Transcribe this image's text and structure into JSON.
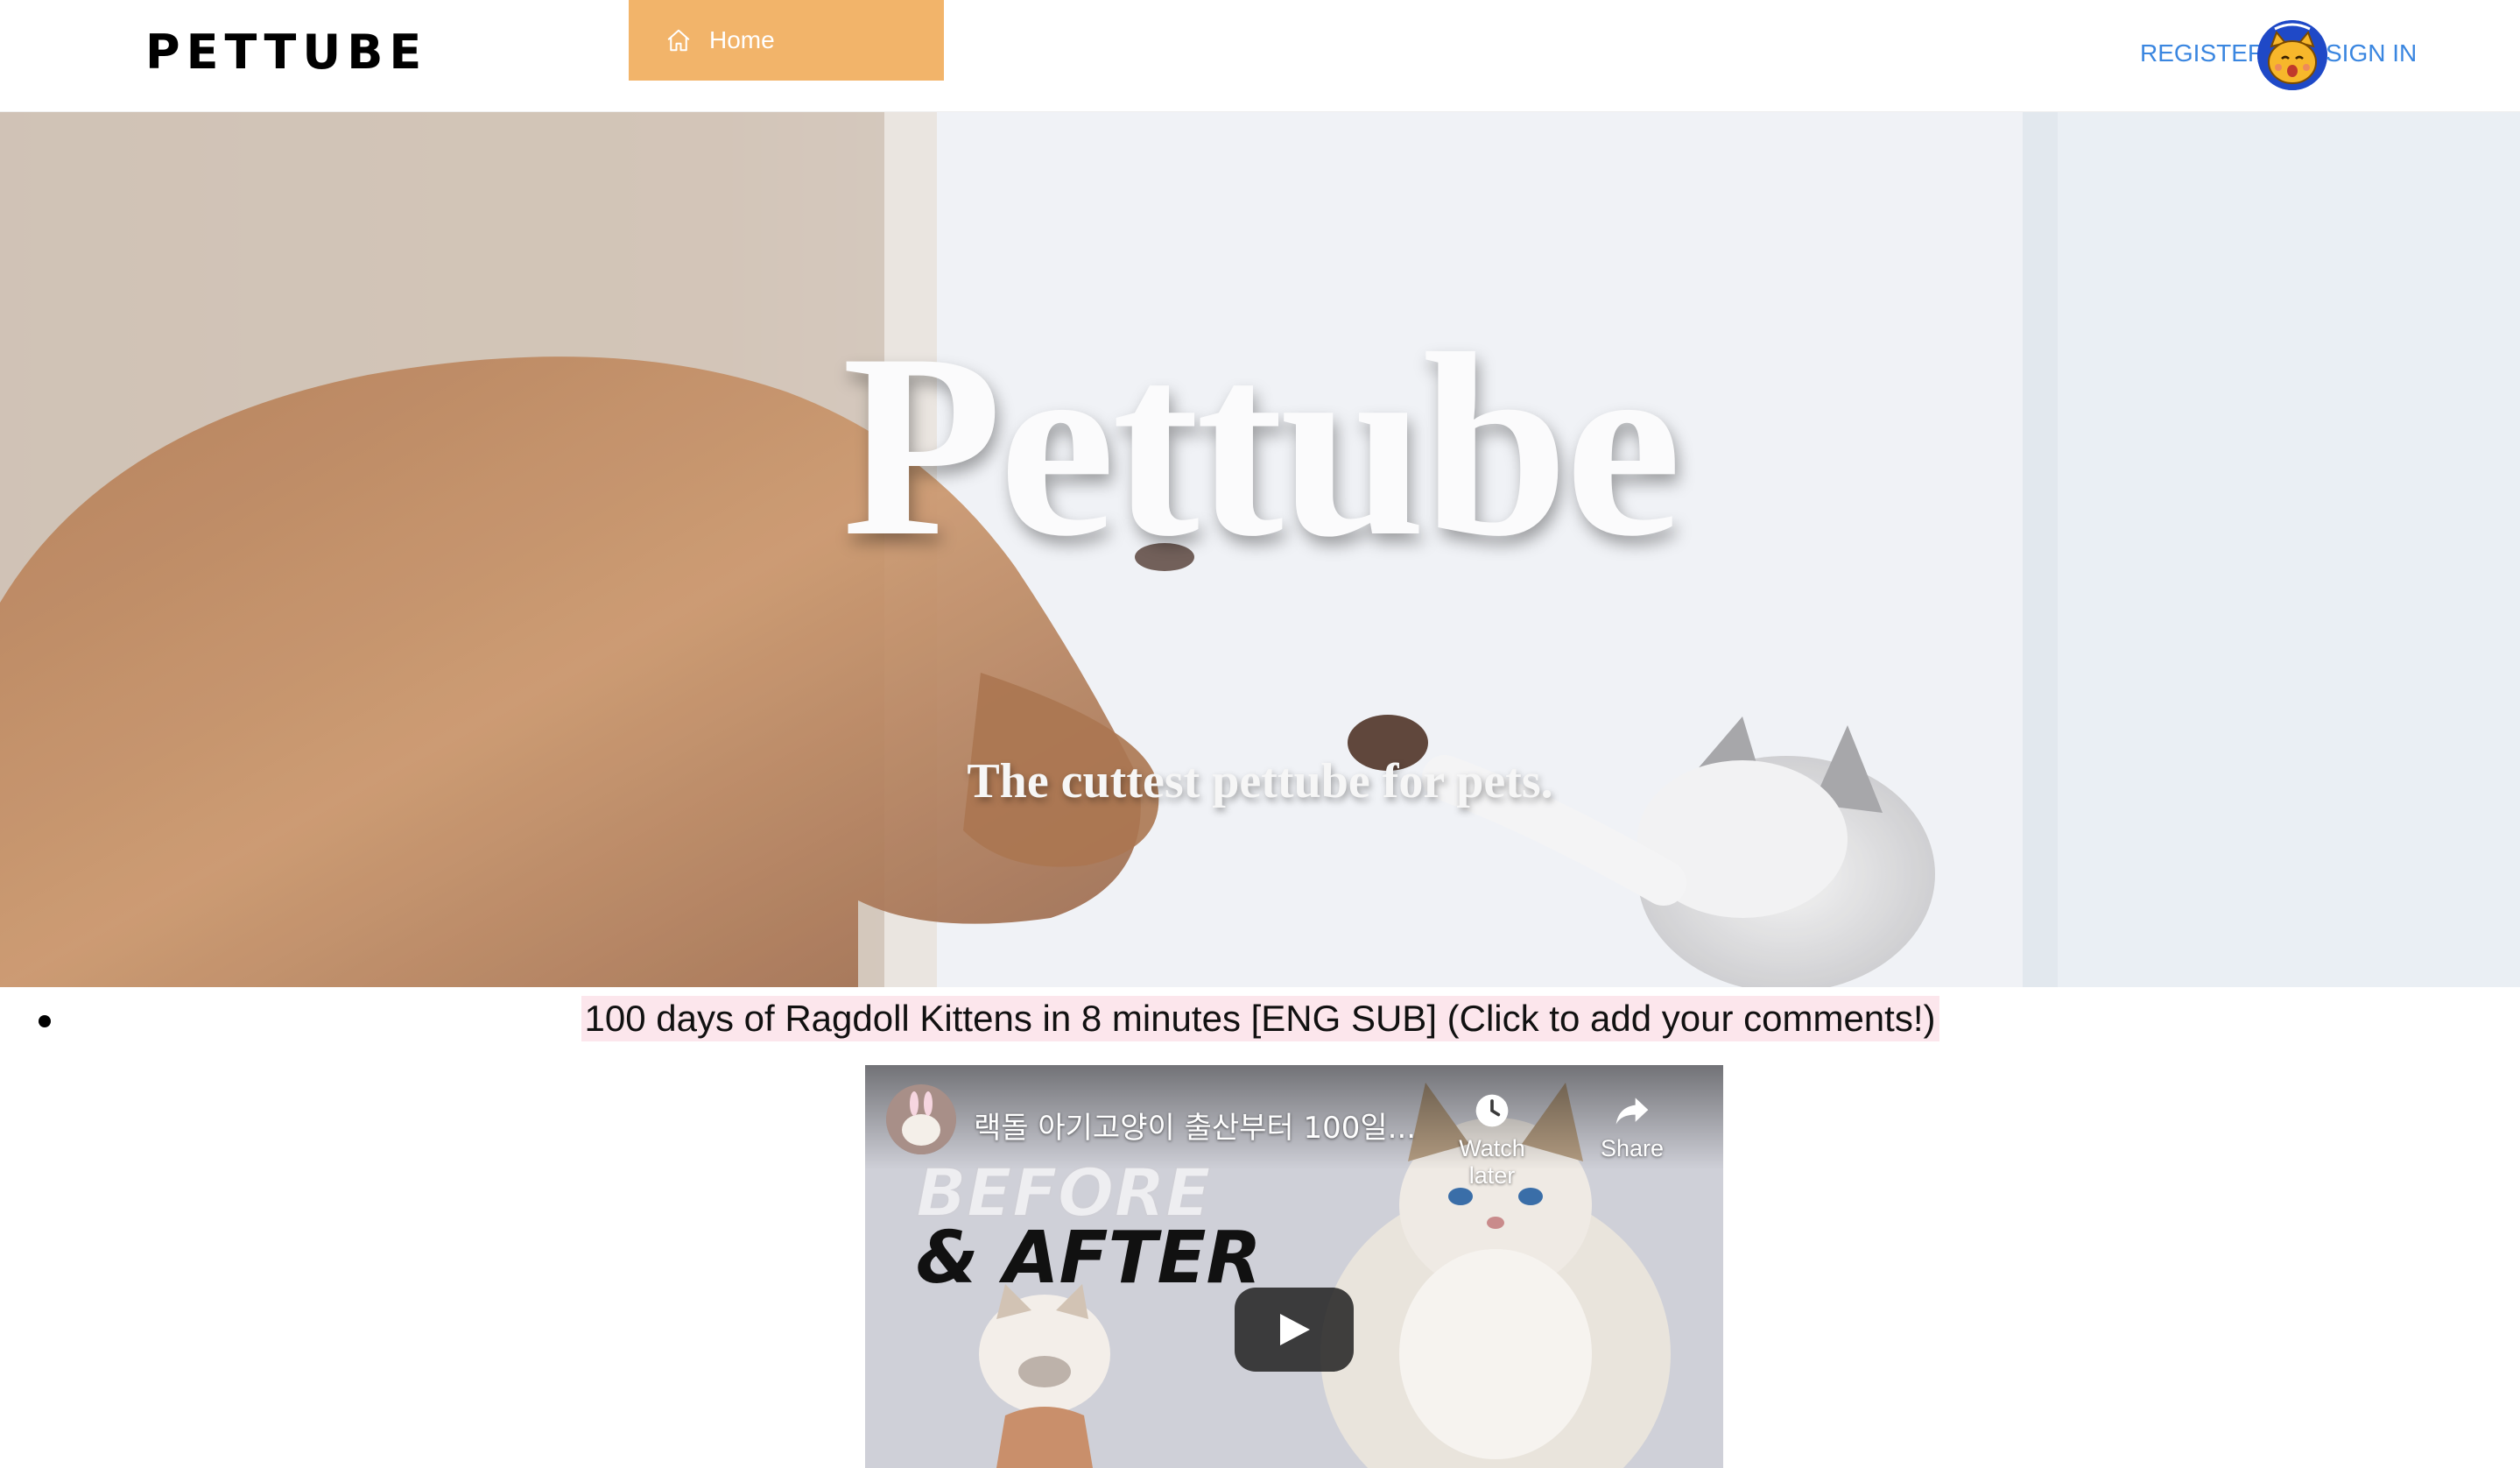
{
  "header": {
    "logo": "PETTUBE",
    "nav": {
      "home_label": "Home",
      "active_color": "#f2b46a"
    },
    "auth": {
      "register_label": "REGISTER",
      "signin_label": "SIGN IN",
      "link_color": "#3a86e0"
    },
    "avatar_icon": "cat-avatar-icon"
  },
  "hero": {
    "title": "Pettube",
    "subtitle": "The cuttest pettube for pets."
  },
  "videos": [
    {
      "title": "100 days of Ragdoll Kittens in 8 minutes [ENG SUB] (Click to add your comments!)",
      "player": {
        "video_title": "랙돌 아기고양이 출산부터 100일...",
        "thumbnail_text_top": "BEFORE",
        "thumbnail_text_bottom": "& AFTER",
        "watch_later_label": "Watch later",
        "share_label": "Share",
        "icons": [
          "clock-icon",
          "share-arrow-icon",
          "play-icon"
        ]
      }
    }
  ]
}
